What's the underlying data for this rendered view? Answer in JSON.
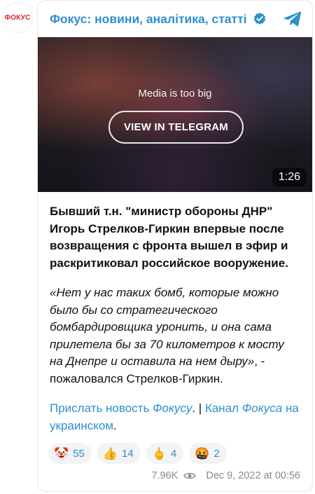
{
  "channel": {
    "avatar_text": "ФОКУС",
    "title": "Фокус: новини, аналітика, статті"
  },
  "media": {
    "note": "Media is too big",
    "button_label": "VIEW IN TELEGRAM",
    "duration": "1:26"
  },
  "post": {
    "lead": "Бывший т.н. \"министр обороны ДНР\" Игорь Стрелков-Гиркин впервые после возвращения с фронта вышел в эфир и раскритиковал российское вооружение.",
    "quote": "«Нет у нас таких бомб, которые можно было бы со стратегического бомбардировщика уронить, и она сама прилетела бы за 70 километров к мосту на Днепре и оставила на нем дыру»",
    "quote_tail": ", - пожаловался Стрелков-Гиркин.",
    "link1_a": "Прислать новость ",
    "link1_b": "Фокусу",
    "separator": ". | ",
    "link2_a": "Канал ",
    "link2_b": "Фокуса",
    "link2_c": " на украинском",
    "end": "."
  },
  "reactions": [
    {
      "emoji": "🤡",
      "count": "55"
    },
    {
      "emoji": "👍",
      "count": "14"
    },
    {
      "emoji": "🖕",
      "count": "4"
    },
    {
      "emoji": "🤬",
      "count": "2"
    }
  ],
  "footer": {
    "views": "7.96K",
    "date": "Dec 9, 2022 at 00:56"
  },
  "colors": {
    "accent": "#2f8fcf",
    "brand_red": "#e0202a"
  }
}
